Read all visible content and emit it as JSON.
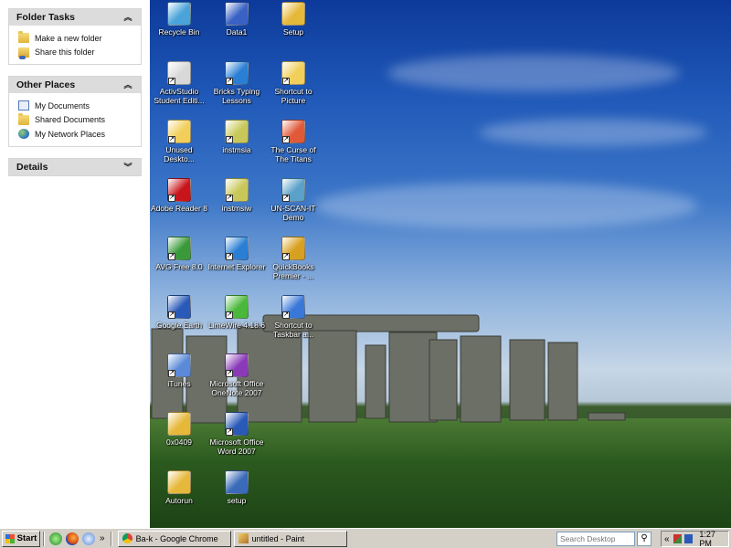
{
  "task_pane": {
    "folder_tasks": {
      "title": "Folder Tasks",
      "items": [
        {
          "label": "Make a new folder",
          "icon": "new-folder-icon"
        },
        {
          "label": "Share this folder",
          "icon": "share-folder-icon"
        }
      ]
    },
    "other_places": {
      "title": "Other Places",
      "items": [
        {
          "label": "My Documents",
          "icon": "my-documents-icon"
        },
        {
          "label": "Shared Documents",
          "icon": "folder-icon"
        },
        {
          "label": "My Network Places",
          "icon": "network-places-icon"
        }
      ]
    },
    "details": {
      "title": "Details"
    }
  },
  "desktop_icons": [
    {
      "label": "Recycle Bin",
      "icon": "recycle-bin-icon",
      "color": "#4aa3d9"
    },
    {
      "label": "Data1",
      "icon": "file-icon",
      "color": "#3a62c4"
    },
    {
      "label": "Setup",
      "icon": "setup-icon",
      "color": "#e6b83a"
    },
    {
      "label": "ActivStudio Student Editi...",
      "icon": "activstudio-icon",
      "color": "#d8d8d8"
    },
    {
      "label": "Bricks Typing Lessons",
      "icon": "internet-explorer-icon",
      "color": "#2a7fd4"
    },
    {
      "label": "Shortcut to Picture",
      "icon": "folder-icon",
      "color": "#f1cf5a"
    },
    {
      "label": "Unused Deskto...",
      "icon": "folder-icon",
      "color": "#f1cf5a"
    },
    {
      "label": "instmsia",
      "icon": "installer-icon",
      "color": "#c8c85a"
    },
    {
      "label": "The Curse of The Titans",
      "icon": "document-icon",
      "color": "#e05a3a"
    },
    {
      "label": "Adobe Reader 8",
      "icon": "adobe-reader-icon",
      "color": "#c8151b"
    },
    {
      "label": "instmsiw",
      "icon": "installer-icon",
      "color": "#c8c85a"
    },
    {
      "label": "UN-SCAN-IT Demo",
      "icon": "scanner-icon",
      "color": "#5aa0c8"
    },
    {
      "label": "AVG Free 8.0",
      "icon": "avg-icon",
      "color": "#3a9a3a"
    },
    {
      "label": "Internet Explorer",
      "icon": "internet-explorer-icon",
      "color": "#2a7fd4"
    },
    {
      "label": "QuickBooks Premier - ...",
      "icon": "quickbooks-icon",
      "color": "#d8a020"
    },
    {
      "label": "Google Earth",
      "icon": "google-earth-icon",
      "color": "#2a5ab8"
    },
    {
      "label": "LimeWire 4.18.6",
      "icon": "limewire-icon",
      "color": "#4ab83a"
    },
    {
      "label": "Shortcut to Taskbar a...",
      "icon": "taskbar-icon",
      "color": "#3a78d8"
    },
    {
      "label": "iTunes",
      "icon": "itunes-icon",
      "color": "#5a8ad8"
    },
    {
      "label": "Microsoft Office OneNote 2007",
      "icon": "onenote-icon",
      "color": "#8a3ab8"
    },
    {
      "label": "0x0409",
      "icon": "setup-icon",
      "color": "#e6b83a"
    },
    {
      "label": "Microsoft Office Word 2007",
      "icon": "word-icon",
      "color": "#2a5ab8"
    },
    {
      "label": "Autorun",
      "icon": "setup-icon",
      "color": "#e6b83a"
    },
    {
      "label": "setup",
      "icon": "setup-icon",
      "color": "#3a6ab8"
    }
  ],
  "taskbar": {
    "start_label": "Start",
    "quick_launch_icons": [
      "media-player-icon",
      "firefox-icon",
      "itunes-icon"
    ],
    "overflow_label": "»",
    "windows": [
      {
        "label": "Ba-k - Google Chrome",
        "icon": "chrome-icon"
      },
      {
        "label": "untitled - Paint",
        "icon": "paint-icon"
      }
    ],
    "search_placeholder": "Search Desktop",
    "tray_overflow": "«",
    "clock": "1:27 PM"
  }
}
